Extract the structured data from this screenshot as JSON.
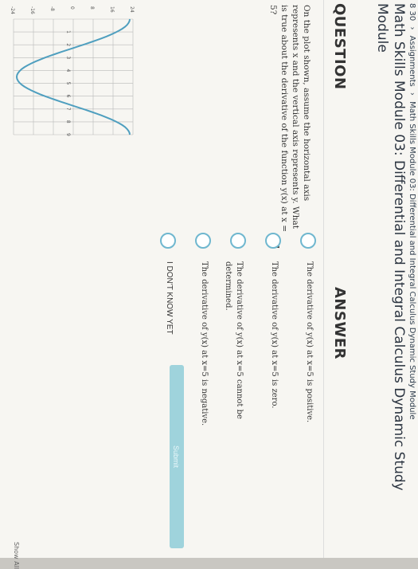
{
  "breadcrumb": {
    "course": "8 30",
    "sep1": "›",
    "assignments": "Assignments",
    "sep2": "›",
    "current": "Math Skills Module 03: Differential and Integral Calculus Dynamic Study Module"
  },
  "page": {
    "title": "Math Skills Module 03: Differential and Integral Calculus Dynamic Study Module"
  },
  "question": {
    "heading": "QUESTION",
    "prompt": "On the plot shown, assume the horizontal axis represents x and the vertical axis represents y. What is true about the derivative of the function y(x) at x = 5?"
  },
  "plot": {
    "y_ticks": [
      "24",
      "16",
      "8",
      "0",
      "-8",
      "-16",
      "-24"
    ],
    "x_ticks": [
      "1",
      "2",
      "3",
      "4",
      "5",
      "6",
      "7",
      "8",
      "9"
    ],
    "curve_color": "#4f9fbf",
    "grid_color": "#b9b9b9"
  },
  "answer": {
    "heading": "ANSWER",
    "options": [
      {
        "label": "The derivative of y(x) at x=5 is positive."
      },
      {
        "label": "The derivative of y(x) at x=5 is zero."
      },
      {
        "label": "The derivative of y(x) at x=5 cannot be determined."
      },
      {
        "label": "The derivative of y(x) at x=5 is negative."
      },
      {
        "label": "I DON'T KNOW YET"
      }
    ],
    "radio_color": "#6fb7cf"
  },
  "actions": {
    "submit_label": "Submit",
    "show_all_label": "Show All"
  }
}
